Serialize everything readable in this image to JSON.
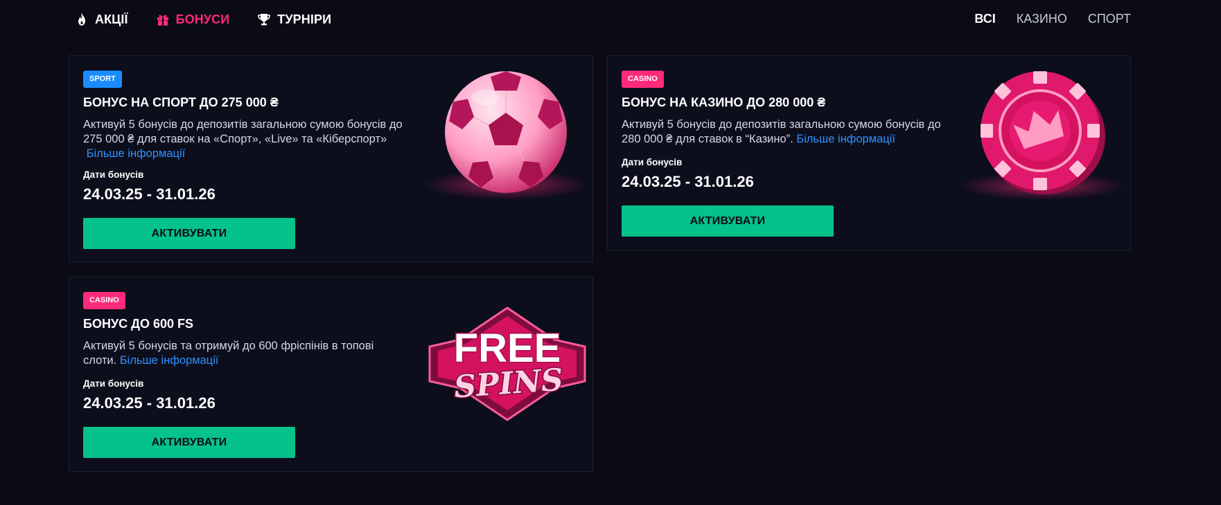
{
  "nav": {
    "items": [
      {
        "label": "АКЦІЇ",
        "icon": "fire-icon"
      },
      {
        "label": "БОНУСИ",
        "icon": "gift-icon"
      },
      {
        "label": "ТУРНІРИ",
        "icon": "trophy-icon"
      }
    ],
    "active_index": 1,
    "filters": [
      {
        "label": "ВСІ"
      },
      {
        "label": "КАЗИНО"
      },
      {
        "label": "СПОРТ"
      }
    ],
    "active_filter": 0
  },
  "cards": [
    {
      "badge": "SPORT",
      "badge_color": "#1a8cff",
      "title": "БОНУС НА СПОРТ ДО 275 000 ₴",
      "desc_l1": "Активуй 5 бонусів до депозитів загальною сумою бонусів до",
      "desc_l2": "275 000 ₴ для ставок на «Спорт», «Live» та «Кіберспорт»",
      "more": "Більше інформації",
      "dates_label": "Дати бонусів",
      "dates": "24.03.25 - 31.01.26",
      "button": "АКТИВУВАТИ",
      "image": "soccer-ball-illustration"
    },
    {
      "badge": "CASINO",
      "badge_color": "#ff2a7a",
      "title": "БОНУС НА КАЗИНО ДО 280 000 ₴",
      "desc_l1": "Активуй 5 бонусів до депозитів загальною сумою бонусів до",
      "desc_l2": "280 000 ₴ для ставок в “Казино”.",
      "more": "Більше інформації",
      "dates_label": "Дати бонусів",
      "dates": "24.03.25 - 31.01.26",
      "button": "АКТИВУВАТИ",
      "image": "casino-chip-illustration"
    },
    {
      "badge": "CASINO",
      "badge_color": "#ff2a7a",
      "title": "БОНУС ДО 600 FS",
      "desc_l1": "Активуй 5 бонусів та отримуй до 600 фріспінів в топові",
      "desc_l2": "слоти.",
      "more": "Більше інформації",
      "dates_label": "Дати бонусів",
      "dates": "24.03.25 - 31.01.26",
      "button": "АКТИВУВАТИ",
      "image": "free-spins-logo",
      "image_text_1": "FREE",
      "image_text_2": "SPINS"
    }
  ],
  "colors": {
    "background": "#0a0b15",
    "card": "#0c0e1c",
    "accent_pink": "#ff2a7a",
    "accent_green": "#04c28a",
    "link_blue": "#2e92ff"
  }
}
